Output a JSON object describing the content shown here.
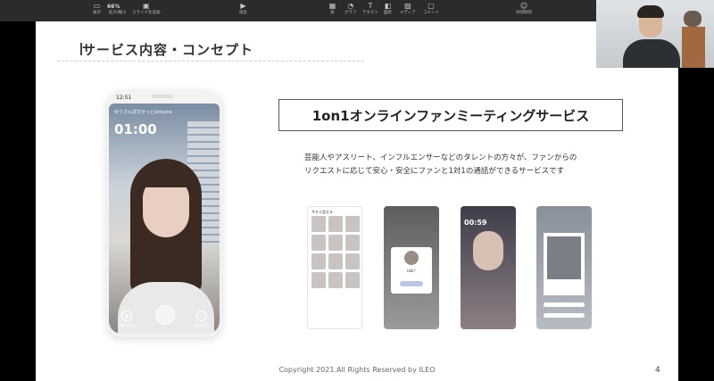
{
  "toolbar": {
    "zoom": "66%",
    "items": [
      {
        "label": "表示",
        "icon": "view-icon"
      },
      {
        "label": "拡大/縮小",
        "icon": "zoom-icon"
      },
      {
        "label": "スライドを追加",
        "icon": "add-slide-icon"
      },
      {
        "label": "再生",
        "icon": "play-icon"
      },
      {
        "label": "表",
        "icon": "table-icon"
      },
      {
        "label": "グラフ",
        "icon": "chart-icon"
      },
      {
        "label": "テキスト",
        "icon": "text-icon"
      },
      {
        "label": "図形",
        "icon": "shape-icon"
      },
      {
        "label": "メディア",
        "icon": "media-icon"
      },
      {
        "label": "コメント",
        "icon": "comment-icon"
      },
      {
        "label": "共同制作",
        "icon": "collaborate-icon"
      }
    ]
  },
  "slide": {
    "section_title": "サービス内容・コンセプト",
    "service_title": "1on1オンラインファンミーティングサービス",
    "desc_line1": "芸能人やアスリート、インフルエンサーなどのタレントの方々が、ファンからの",
    "desc_line2": "リクエストに応じて安心・安全にファンと1対1の通話ができるサービスです",
    "phone": {
      "time": "12:51",
      "user": "ゆうさんぽすかっとonlyone",
      "timer": "01:00",
      "left_btn": "写真を撮る",
      "right_btn": "通話終了"
    },
    "mini_screens": {
      "s1_title": "今すぐ話せる",
      "s2_text": "talk?",
      "s3_timer": "00:59"
    },
    "copyright": "Copyright 2021.All Rights Reserved by ILEO",
    "page_number": "4"
  }
}
